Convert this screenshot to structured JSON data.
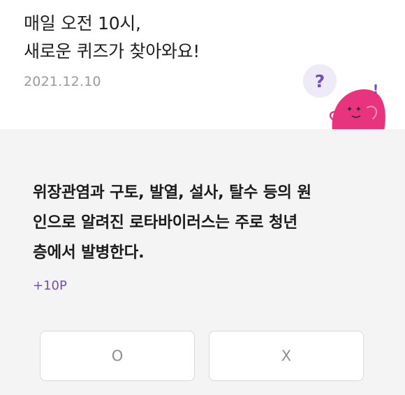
{
  "header": {
    "headline_line1": "매일 오전 10시,",
    "headline_line2": "새로운 퀴즈가 찾아와요!",
    "date": "2021.12.10",
    "mascot": {
      "icon": "quiz-mascot-icon",
      "bubble_question": "?",
      "exclaim": "!",
      "colors": {
        "body": "#e8337e",
        "question_mark": "#7250b8",
        "bubble": "#eeeaf7"
      }
    }
  },
  "quiz": {
    "question_lines": [
      "위장관염과 구토, 발열, 설사, 탈수 등의 원",
      "인으로 알려진 로타바이러스는 주로 청년",
      "층에서 발병한다."
    ],
    "points": "+10P",
    "answers": {
      "o_label": "O",
      "x_label": "X"
    },
    "colors": {
      "accent": "#7250b8",
      "background": "#f4f4f4"
    }
  }
}
